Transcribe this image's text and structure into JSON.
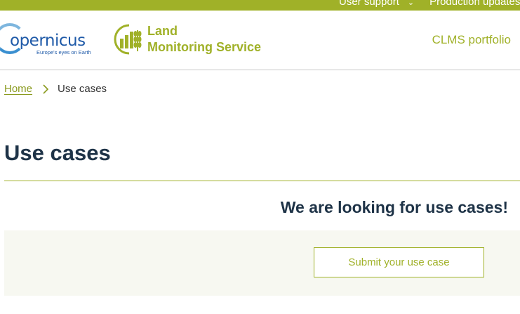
{
  "topbar": {
    "items": [
      "User support",
      "Production updates"
    ]
  },
  "header": {
    "copernicus_logo": {
      "word": "opernicus",
      "tagline": "Europe's eyes on Earth"
    },
    "clms_logo": {
      "line1": "Land",
      "line2": "Monitoring Service"
    },
    "portfolio_label": "CLMS portfolio"
  },
  "breadcrumb": {
    "home": "Home",
    "current": "Use cases"
  },
  "main": {
    "title": "Use cases",
    "cta_heading": "We are looking for use cases!",
    "cta_button": "Submit your use case"
  },
  "colors": {
    "brand_green": "#a0b128",
    "heading_navy": "#1e3347",
    "cta_background": "#f7f8f1"
  },
  "icons": [
    "chevron-down-icon",
    "breadcrumb-chevron-icon",
    "clms-wheat-icon",
    "copernicus-ring-icon"
  ]
}
